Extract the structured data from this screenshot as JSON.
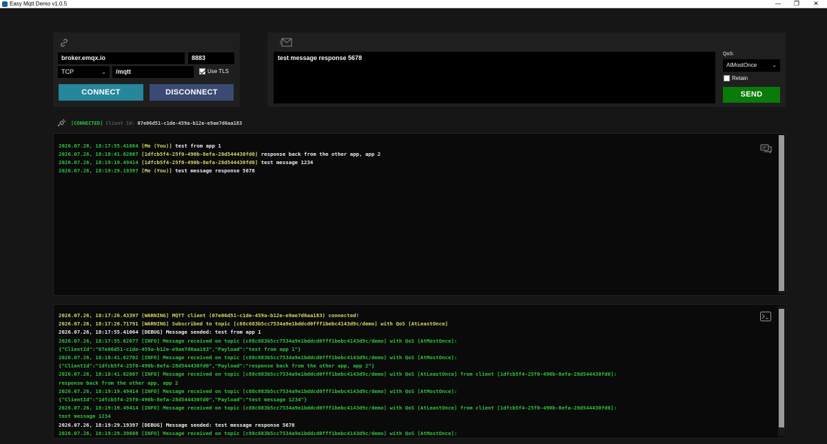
{
  "window": {
    "title": "Easy Mqtt Demo v1.0.5",
    "minimize": "—",
    "maximize": "❐",
    "close": "✕"
  },
  "connection": {
    "host": "broker.emqx.io",
    "port": "8883",
    "protocol": "TCP",
    "path": "/mqtt",
    "use_tls_label": "Use TLS",
    "use_tls": true,
    "connect_label": "CONNECT",
    "disconnect_label": "DISCONNECT"
  },
  "publish": {
    "message": "test message response 5678",
    "qos_label": "QoS:",
    "qos_value": "AtMostOnce",
    "retain_label": "Retain",
    "retain": false,
    "send_label": "SEND"
  },
  "status": {
    "state": "[CONNECTED]",
    "client_id_label": "Client Id:",
    "client_id": "07e06d51-c1de-459a-b12e-e9ae7d6aa183"
  },
  "messages": [
    {
      "ts": "2026.07.26, 18:17:55.41064",
      "from": "[Me (You)]",
      "from_kind": "me",
      "text": "test from app 1"
    },
    {
      "ts": "2026.07.26, 18:18:41.62807",
      "from": "[1dfcb5f4-25f0-490b-8efa-28d544430fd0]",
      "from_kind": "peer",
      "text": "response back from the other app, app 2"
    },
    {
      "ts": "2026.07.26, 18:19:19.49414",
      "from": "[1dfcb5f4-25f0-490b-8efa-28d544430fd0]",
      "from_kind": "peer",
      "text": "test message 1234"
    },
    {
      "ts": "2026.07.26, 18:19:29.19397",
      "from": "[Me (You)]",
      "from_kind": "me",
      "text": "test message response 5678"
    }
  ],
  "system_log": [
    {
      "level": "warn",
      "text": "2026.07.26, 18:17:26.43397 [WARNING] MQTT client (07e06d51-c1de-459a-b12e-e9ae7d6aa183) connected!"
    },
    {
      "level": "warn",
      "text": "2026.07.26, 18:17:26.71791 [WARNING] Subscribed to topic [c88c683b5cc7534a9e1bddcd0fff1bebc4143d9c/demo] with QoS [AtLeastOnce]"
    },
    {
      "level": "dbg",
      "text": "2026.07.26, 18:17:55.41064 [DEBUG] Message sended: test from app 1"
    },
    {
      "level": "info",
      "text": "2026.07.26, 18:17:55.62077 [INFO] Message received on topic [c88c683b5cc7534a9e1bddcd0fff1bebc4143d9c/demo] with QoS [AtMostOnce]:"
    },
    {
      "level": "info",
      "text": "{\"ClientId\":\"07e06d51-c1de-459a-b12e-e9ae7d6aa183\",\"Payload\":\"test from app 1\"}"
    },
    {
      "level": "info",
      "text": "2026.07.26, 18:18:41.62702 [INFO] Message received on topic [c88c683b5cc7534a9e1bddcd0fff1bebc4143d9c/demo] with QoS [AtMostOnce]:"
    },
    {
      "level": "info",
      "text": "{\"ClientId\":\"1dfcb5f4-25f0-490b-8efa-28d544430fd0\",\"Payload\":\"response back from the other app, app 2\"}"
    },
    {
      "level": "info",
      "text": "2026.07.26, 18:18:41.62807 [INFO] Message received on topic [c88c683b5cc7534a9e1bddcd0fff1bebc4143d9c/demo] with QoS [AtLeastOnce] from client [1dfcb5f4-25f0-490b-8efa-28d544430fd0]:"
    },
    {
      "level": "info",
      "text": "response back from the other app, app 2"
    },
    {
      "level": "info",
      "text": "2026.07.26, 18:19:19.49414 [INFO] Message received on topic [c88c683b5cc7534a9e1bddcd0fff1bebc4143d9c/demo] with QoS [AtMostOnce]:"
    },
    {
      "level": "info",
      "text": "{\"ClientId\":\"1dfcb5f4-25f0-490b-8efa-28d544430fd0\",\"Payload\":\"test message 1234\"}"
    },
    {
      "level": "info",
      "text": "2026.07.26, 18:19:19.49414 [INFO] Message received on topic [c88c683b5cc7534a9e1bddcd0fff1bebc4143d9c/demo] with QoS [AtLeastOnce] from client [1dfcb5f4-25f0-490b-8efa-28d544430fd0]:"
    },
    {
      "level": "info",
      "text": "test message 1234"
    },
    {
      "level": "dbg",
      "text": "2026.07.26, 18:19:29.19397 [DEBUG] Message sended: test message response 5678"
    },
    {
      "level": "info",
      "text": "2026.07.26, 18:19:29.39608 [INFO] Message received on topic [c88c683b5cc7534a9e1bddcd0fff1bebc4143d9c/demo] with QoS [AtMostOnce]:"
    }
  ],
  "icons": {
    "link": "link-icon",
    "envelope": "envelope-icon",
    "plug": "plug-icon",
    "chat": "chat-icon",
    "terminal": "terminal-icon"
  },
  "colors": {
    "connect": "#26869a",
    "disconnect": "#3a4a73",
    "send": "#0a7a0a",
    "connected": "#2fc43b",
    "warning": "#d7d86a"
  }
}
